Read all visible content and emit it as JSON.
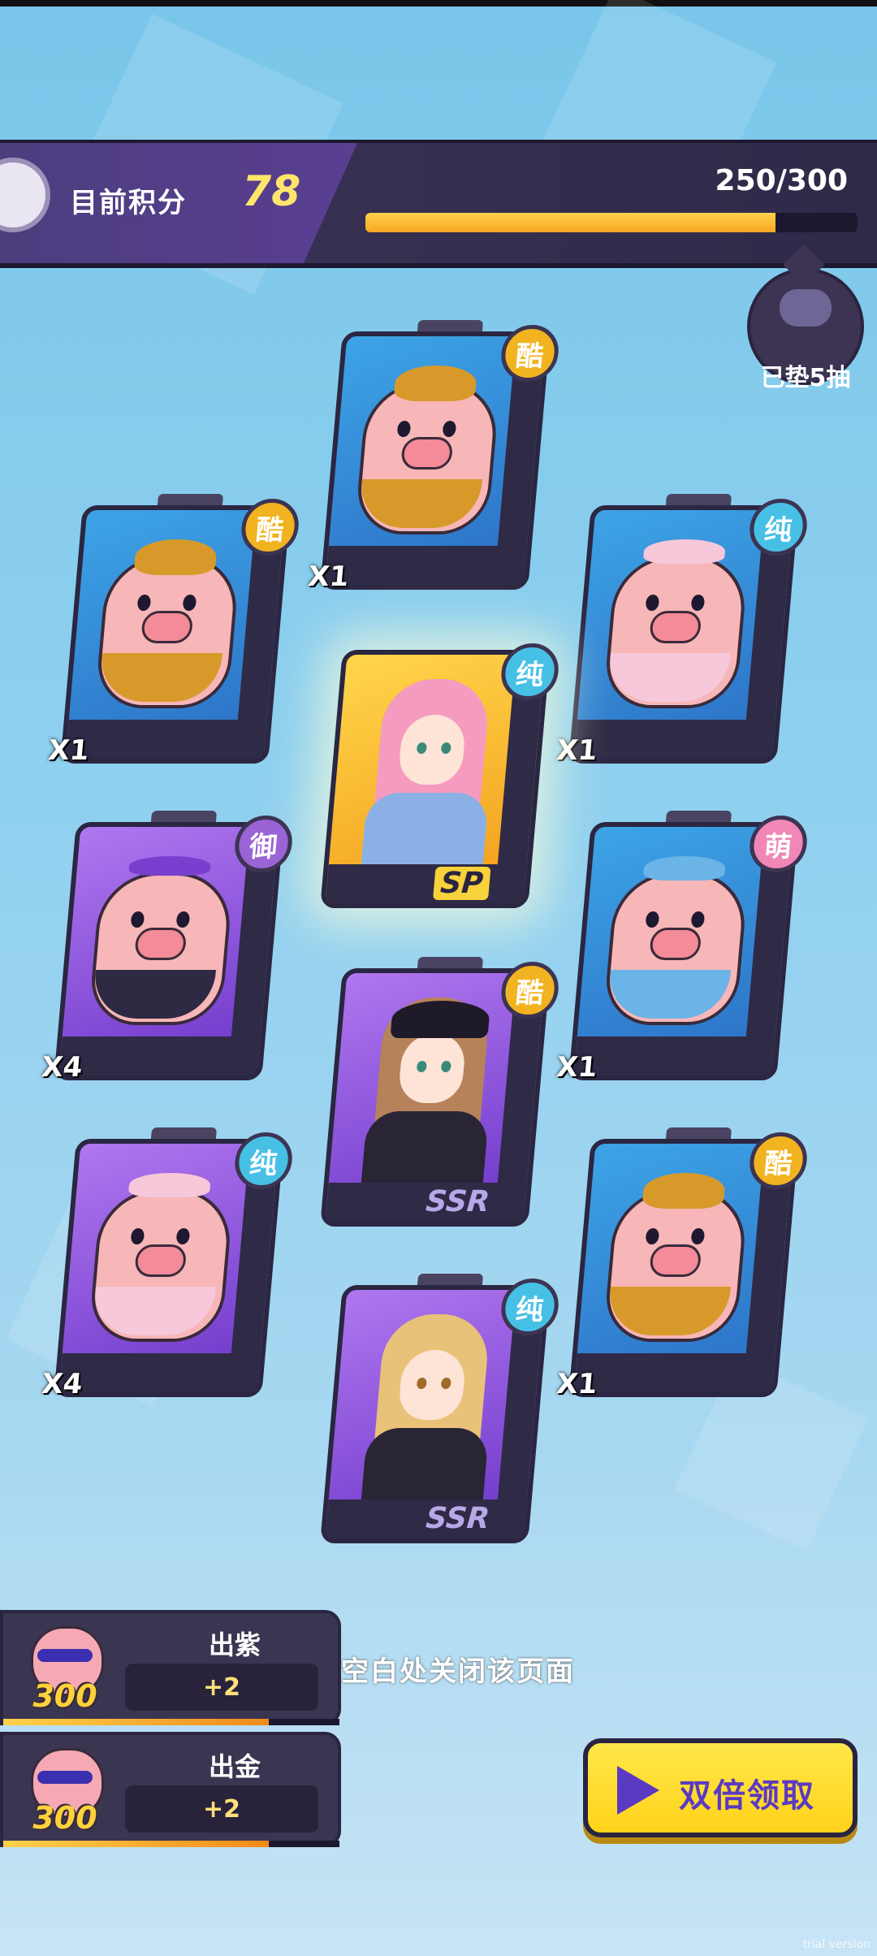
{
  "score": {
    "label": "目前积分",
    "value": "78",
    "progress_text": "250/300",
    "progress_fraction": 0.833
  },
  "pity": {
    "text": "已垫5抽"
  },
  "cards": [
    {
      "badge": "酷",
      "count": "X1",
      "rarity": ""
    },
    {
      "badge": "酷",
      "count": "X1",
      "rarity": ""
    },
    {
      "badge": "纯",
      "count": "X1",
      "rarity": ""
    },
    {
      "badge": "纯",
      "count": "",
      "rarity": "SP"
    },
    {
      "badge": "御",
      "count": "X4",
      "rarity": ""
    },
    {
      "badge": "萌",
      "count": "X1",
      "rarity": ""
    },
    {
      "badge": "酷",
      "count": "",
      "rarity": "SSR"
    },
    {
      "badge": "纯",
      "count": "X4",
      "rarity": ""
    },
    {
      "badge": "酷",
      "count": "X1",
      "rarity": ""
    },
    {
      "badge": "纯",
      "count": "",
      "rarity": "SSR"
    }
  ],
  "rewards": [
    {
      "icon_value": "300",
      "title": "出紫",
      "bonus": "+2",
      "progress_fraction": 0.79
    },
    {
      "icon_value": "300",
      "title": "出金",
      "bonus": "+2",
      "progress_fraction": 0.79
    }
  ],
  "close_hint": "空白处关闭该页面",
  "double_button": {
    "label": "双倍领取",
    "icon": "play-icon"
  },
  "watermark": "trial version",
  "colors": {
    "gold": "#f2b320",
    "purple": "#8a4fe0",
    "accent_yellow": "#ffd21a",
    "button_text": "#5b3ac2"
  }
}
